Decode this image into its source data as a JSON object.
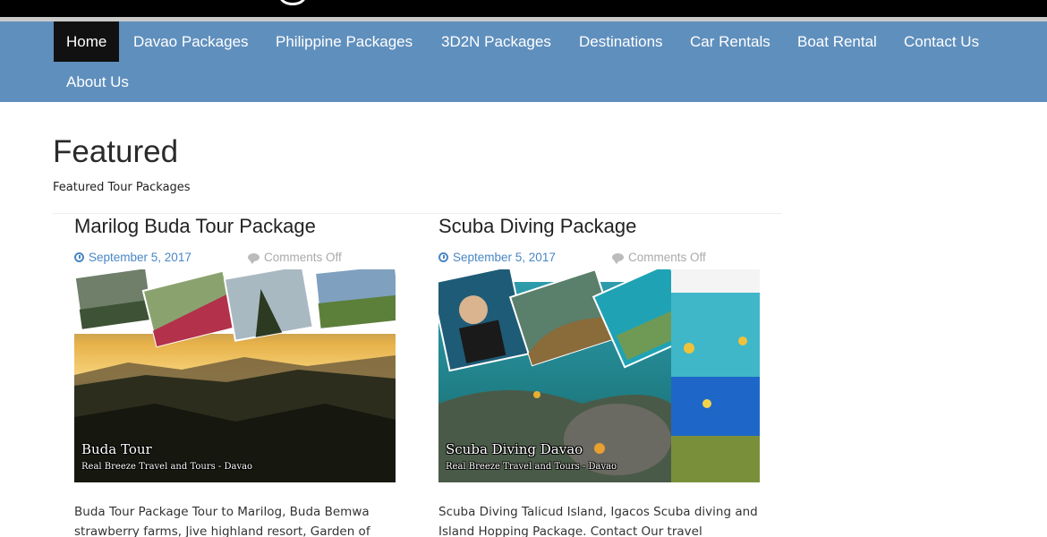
{
  "nav": {
    "items": [
      {
        "label": "Home",
        "active": true
      },
      {
        "label": "Davao Packages"
      },
      {
        "label": "Philippine Packages"
      },
      {
        "label": "3D2N Packages"
      },
      {
        "label": "Destinations"
      },
      {
        "label": "Car Rentals"
      },
      {
        "label": "Boat Rental"
      },
      {
        "label": "Contact Us"
      },
      {
        "label": "About Us"
      }
    ]
  },
  "page": {
    "title": "Featured",
    "subtitle": "Featured Tour Packages"
  },
  "posts": [
    {
      "title": "Marilog Buda Tour Package",
      "date": "September 5, 2017",
      "comments": "Comments Off",
      "image_caption": "Buda Tour",
      "image_subcaption": "Real Breeze Travel and Tours - Davao",
      "excerpt": "Buda Tour Package Tour to Marilog, Buda Bemwa strawberry farms, Jive highland resort, Garden of"
    },
    {
      "title": "Scuba Diving Package",
      "date": "September 5, 2017",
      "comments": "Comments Off",
      "image_caption": "Scuba Diving Davao",
      "image_subcaption": "Real Breeze Travel and Tours - Davao",
      "excerpt": "Scuba Diving Talicud Island, Igacos Scuba diving and Island Hopping Package. Contact Our travel Consultant"
    }
  ],
  "colors": {
    "nav_bg": "#5f8fbd",
    "nav_active": "#111111",
    "link": "#4a86c5"
  }
}
